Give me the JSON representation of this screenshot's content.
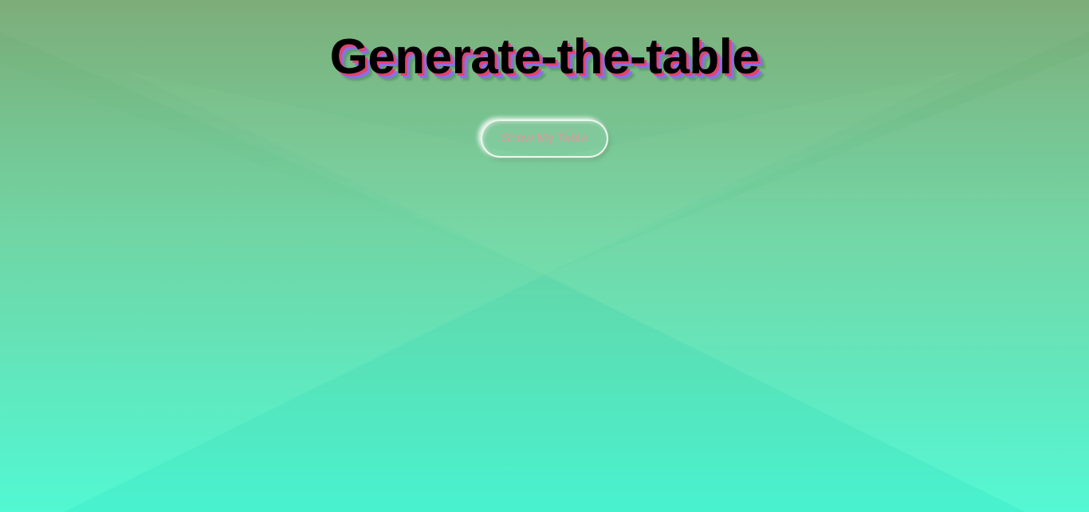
{
  "page": {
    "title": "Generate-the-table"
  },
  "actions": {
    "show_table_label": "Show My Table"
  },
  "colors": {
    "background_top": "#79ab75",
    "background_middle": "#6fd5a3",
    "background_bottom": "#4ef8d3",
    "title_text": "#000000",
    "title_shadow_pink": "#e0446e",
    "title_shadow_purple": "#8a6ee8",
    "button_border": "#ffffff",
    "button_text": "#d99a9a"
  }
}
